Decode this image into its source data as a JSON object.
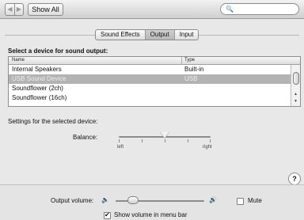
{
  "toolbar": {
    "back_icon": "chevron-left",
    "forward_icon": "chevron-right",
    "show_all_label": "Show All",
    "search_placeholder": "",
    "search_icon": "magnifier"
  },
  "tabs": [
    {
      "label": "Sound Effects",
      "active": false
    },
    {
      "label": "Output",
      "active": true
    },
    {
      "label": "Input",
      "active": false
    }
  ],
  "device_section": {
    "title": "Select a device for sound output:",
    "columns": [
      "Name",
      "Type"
    ],
    "rows": [
      {
        "name": "Internal Speakers",
        "type": "Built-in",
        "selected": false
      },
      {
        "name": "USB Sound Device",
        "type": "USB",
        "selected": true
      },
      {
        "name": "Soundflower (2ch)",
        "type": "",
        "selected": false
      },
      {
        "name": "Soundflower (16ch)",
        "type": "",
        "selected": false
      }
    ]
  },
  "settings": {
    "label": "Settings for the selected device:",
    "balance_label": "Balance:",
    "left_label": "left",
    "right_label": "right",
    "balance_value": 0.5
  },
  "output": {
    "volume_label": "Output volume:",
    "volume_value": 0.15,
    "mute_label": "Mute",
    "mute_checked": false,
    "show_volume_label": "Show volume in menu bar",
    "show_volume_checked": true
  },
  "help_label": "?"
}
